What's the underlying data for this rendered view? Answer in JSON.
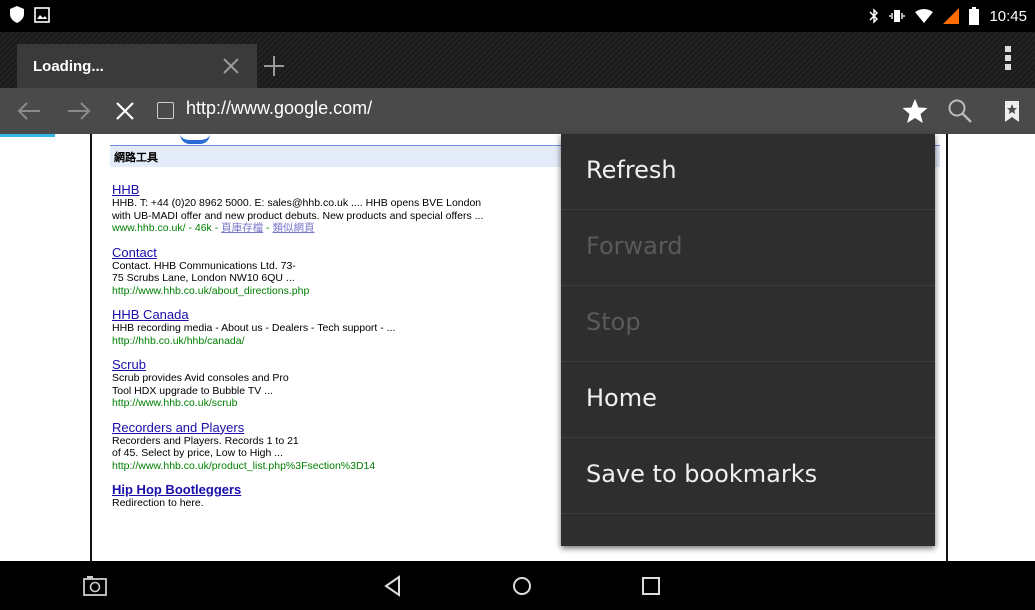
{
  "status_bar": {
    "time": "10:45",
    "icons": [
      "shield-icon",
      "image-notification-icon",
      "bluetooth-icon",
      "vibrate-icon",
      "wifi-icon",
      "signal-icon",
      "battery-icon"
    ]
  },
  "tabs": [
    {
      "title": "Loading..."
    }
  ],
  "address_bar": {
    "url": "http://www.google.com/"
  },
  "page": {
    "section_header": "網路工具",
    "results": [
      {
        "title": "HHB",
        "snippet": "HHB. T: +44 (0)20 8962 5000. E: sales@hhb.co.uk .... HHB opens BVE London\nwith UB-MADI offer and new product debuts. New products and special offers ...",
        "url": "www.hhb.co.uk/ - 46k - ",
        "cached": "頁庫存檔",
        "separator": " - ",
        "similar": "類似網頁"
      },
      {
        "title": "Contact",
        "snippet": "Contact. HHB Communications Ltd. 73-\n75 Scrubs Lane, London NW10 6QU ...",
        "url": "http://www.hhb.co.uk/about_directions.php"
      },
      {
        "title": "HHB Canada",
        "snippet": "HHB recording media - About us - Dealers - Tech support - ...",
        "url": "http://hhb.co.uk/hhb/canada/"
      },
      {
        "title": "Scrub",
        "snippet": "Scrub provides Avid consoles and Pro\nTool HDX upgrade to Bubble TV ...",
        "url": "http://www.hhb.co.uk/scrub"
      },
      {
        "title": "Recorders and Players",
        "snippet": "Recorders and Players. Records 1 to 21\nof 45. Select by price, Low to High ...",
        "url": "http://www.hhb.co.uk/product_list.php%3Fsection%3D14"
      },
      {
        "title": "Hip Hop Bootleggers",
        "snippet": "Redirection to here.",
        "url": ""
      }
    ]
  },
  "menu": {
    "items": [
      {
        "label": "Refresh",
        "enabled": true
      },
      {
        "label": "Forward",
        "enabled": false
      },
      {
        "label": "Stop",
        "enabled": false
      },
      {
        "label": "Home",
        "enabled": true
      },
      {
        "label": "Save to bookmarks",
        "enabled": true
      },
      {
        "label": "",
        "enabled": true
      }
    ]
  },
  "colors": {
    "accent": "#33b5e5",
    "link": "#1a0dab",
    "url_green": "#008000"
  }
}
